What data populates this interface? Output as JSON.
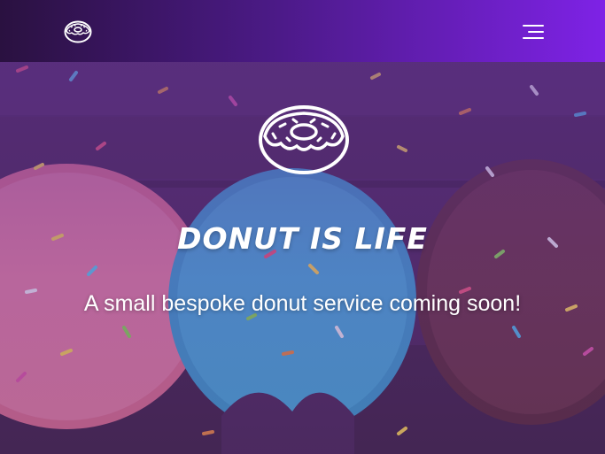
{
  "navbar": {
    "logo_icon": "donut-icon",
    "menu_icon": "hamburger-menu-icon",
    "gradient_colors": [
      "#2a1140",
      "#4b1a86",
      "#7e22e6"
    ]
  },
  "hero": {
    "icon": "donut-icon",
    "title": "DONUT IS LIFE",
    "subtitle": "A small bespoke donut service coming soon!",
    "background": "photo-of-sprinkled-donuts",
    "overlay_color": "#5f2d96"
  }
}
